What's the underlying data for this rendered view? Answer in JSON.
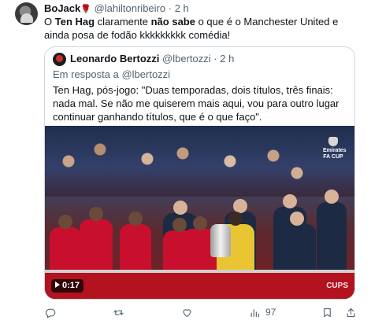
{
  "tweet": {
    "author": {
      "name": "BoJack",
      "emoji": "🌹",
      "handle": "@lahiltonribeiro",
      "separator": "·",
      "time": "2 h"
    },
    "text_parts": [
      "O ",
      "Ten Hag",
      " claramente ",
      "não sabe",
      " o que é o Manchester United e ainda posa de fodão kkkkkkkkk comédia!"
    ],
    "quote": {
      "author": {
        "name": "Leonardo Bertozzi",
        "handle": "@lbertozzi",
        "separator": "·",
        "time": "2 h"
      },
      "reply_prefix": "Em resposta a",
      "reply_mention": "@lbertozzi",
      "text": "Ten Hag, pós-jogo: \"Duas temporadas, dois títulos, três finais: nada mal. Se não me quiserem mais aqui, vou para outro lugar continuar ganhando títulos, que é o que faço\".",
      "media": {
        "timecode": "0:17",
        "corner_logo": [
          "Emirates",
          "FA CUP"
        ],
        "banner_text": "CUPS"
      }
    },
    "actions": {
      "reply": {
        "icon": "reply-icon",
        "count": ""
      },
      "retweet": {
        "icon": "retweet-icon",
        "count": ""
      },
      "like": {
        "icon": "like-icon",
        "count": ""
      },
      "views": {
        "icon": "views-icon",
        "count": "97"
      },
      "bookmark": {
        "icon": "bookmark-icon",
        "count": ""
      },
      "share": {
        "icon": "share-icon",
        "count": ""
      }
    },
    "colors": {
      "text": "#0f1419",
      "muted": "#536471",
      "border": "#cfd9de",
      "kit_red": "#c8102e"
    }
  }
}
